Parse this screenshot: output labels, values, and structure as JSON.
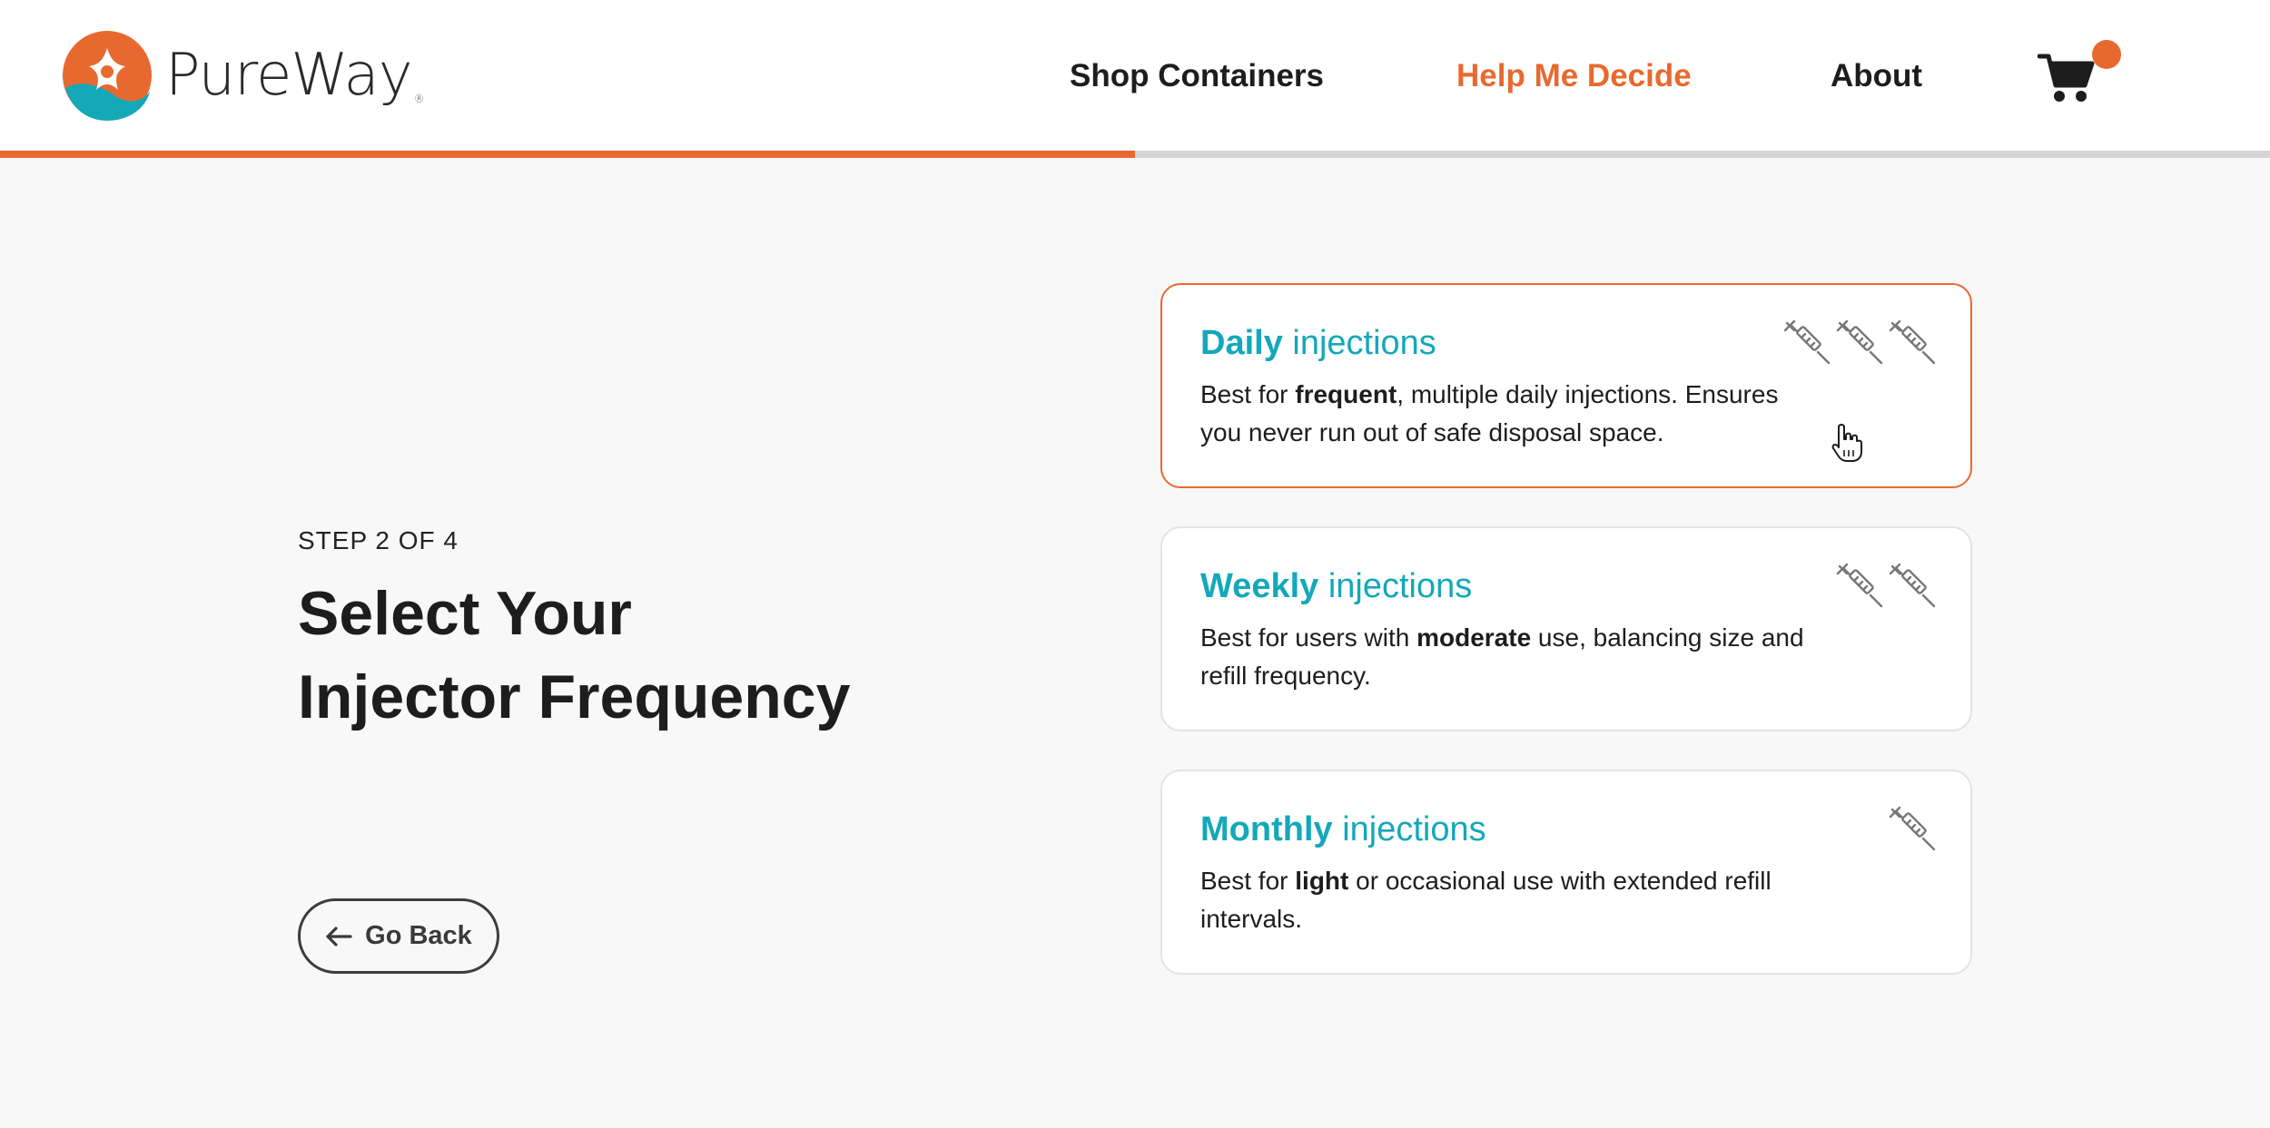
{
  "brand": {
    "name": "PureWay",
    "reg_mark": "®"
  },
  "nav": {
    "shop": "Shop Containers",
    "help": "Help Me Decide",
    "about": "About"
  },
  "progress": {
    "fraction": 0.5
  },
  "colors": {
    "accent": "#e8692f",
    "teal": "#14a8b9",
    "text": "#1d1d1d"
  },
  "wizard": {
    "step": "STEP 2 OF 4",
    "title_line1": "Select Your",
    "title_line2": "Injector Frequency",
    "back": "Go Back"
  },
  "options": [
    {
      "title_bold": "Daily",
      "title_rest": " injections",
      "desc_pre": "Best for ",
      "desc_bold": "frequent",
      "desc_post": ", multiple daily injections. Ensures you never run out of safe disposal space.",
      "syringe_count": 3,
      "selected": true
    },
    {
      "title_bold": "Weekly",
      "title_rest": " injections",
      "desc_pre": "Best for users with ",
      "desc_bold": "moderate",
      "desc_post": " use, balancing size and refill frequency.",
      "syringe_count": 2,
      "selected": false
    },
    {
      "title_bold": "Monthly",
      "title_rest": " injections",
      "desc_pre": "Best for ",
      "desc_bold": "light",
      "desc_post": " or occasional use with extended refill intervals.",
      "syringe_count": 1,
      "selected": false
    }
  ],
  "icons": {
    "logo": "pureway-logo-icon",
    "cart": "shopping-cart-icon",
    "syringe": "syringe-icon",
    "back_arrow": "arrow-left-icon",
    "cursor": "hand-pointer-icon"
  }
}
